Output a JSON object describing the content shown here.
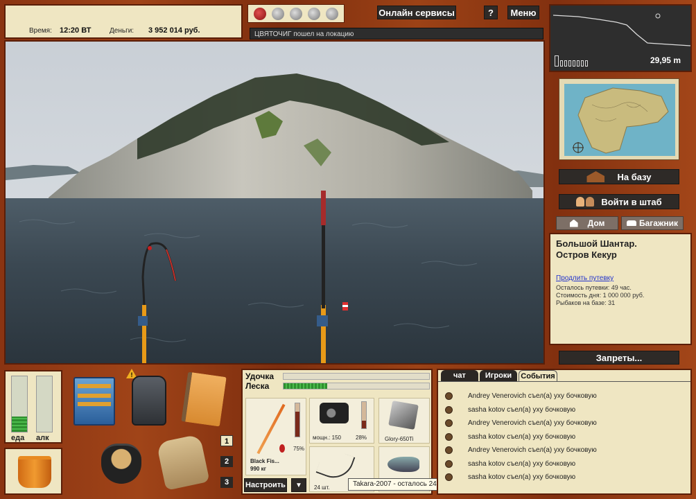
{
  "status": {
    "time_label": "Время:",
    "time_value": "12:20 ВТ",
    "money_label": "Деньги:",
    "money_value": "3 952 014 руб."
  },
  "header": {
    "online_services": "Онлайн сервисы",
    "help": "?",
    "menu": "Меню",
    "news_ticker": "ЦВЯТОЧИГ пошел на локацию",
    "bait_count": 5
  },
  "depth": {
    "value": "29,95 m",
    "bars": 8
  },
  "side": {
    "to_base": "На базу",
    "enter_hq": "Войти в штаб",
    "home": "Дом",
    "trunk": "Багажник",
    "location_name": "Большой Шантар. Остров Кекур",
    "extend_trip": "Продлить путевку",
    "remaining": "Осталось путевки: 49 час.",
    "cost": "Стоимость дня: 1 000 000 руб.",
    "fishers": "Рыбаков на базе: 31",
    "restrictions": "Запреты..."
  },
  "needs": {
    "food_label": "еда",
    "alc_label": "алк",
    "food_level": 0.28,
    "alc_level": 0.0
  },
  "inventory": {
    "warning": "!",
    "slot_numbers": [
      "1",
      "2",
      "3"
    ]
  },
  "tackle": {
    "rod_label": "Удочка",
    "line_label": "Леска",
    "line_level": 0.3,
    "rod_name": "Black Fis...",
    "rod_weight": "990 кг",
    "float_pct": "75%",
    "reel_power": "мощн.: 150",
    "reel_pct": "28%",
    "bait_name": "Glory-650Ti",
    "hook_count": "24 шт.",
    "tooltip": "Takara-2007 - осталось 24 шт.",
    "configure": "Настроить",
    "dropdown": "▼"
  },
  "chat": {
    "tabs": [
      "чат",
      "Игроки",
      "События"
    ],
    "events": [
      "Andrey Venerovich съел(а) уху бочковую",
      "sasha kotov съел(а) уху бочковую",
      "Andrey Venerovich съел(а) уху бочковую",
      "sasha kotov съел(а) уху бочковую",
      "Andrey Venerovich съел(а) уху бочковую",
      "sasha kotov съел(а) уху бочковую",
      "sasha kotov съел(а) уху бочковую"
    ]
  },
  "colors": {
    "wood": "#8f3a14",
    "panel": "#efe6c2",
    "dark_button": "#2e2a27",
    "link": "#2233cc"
  }
}
